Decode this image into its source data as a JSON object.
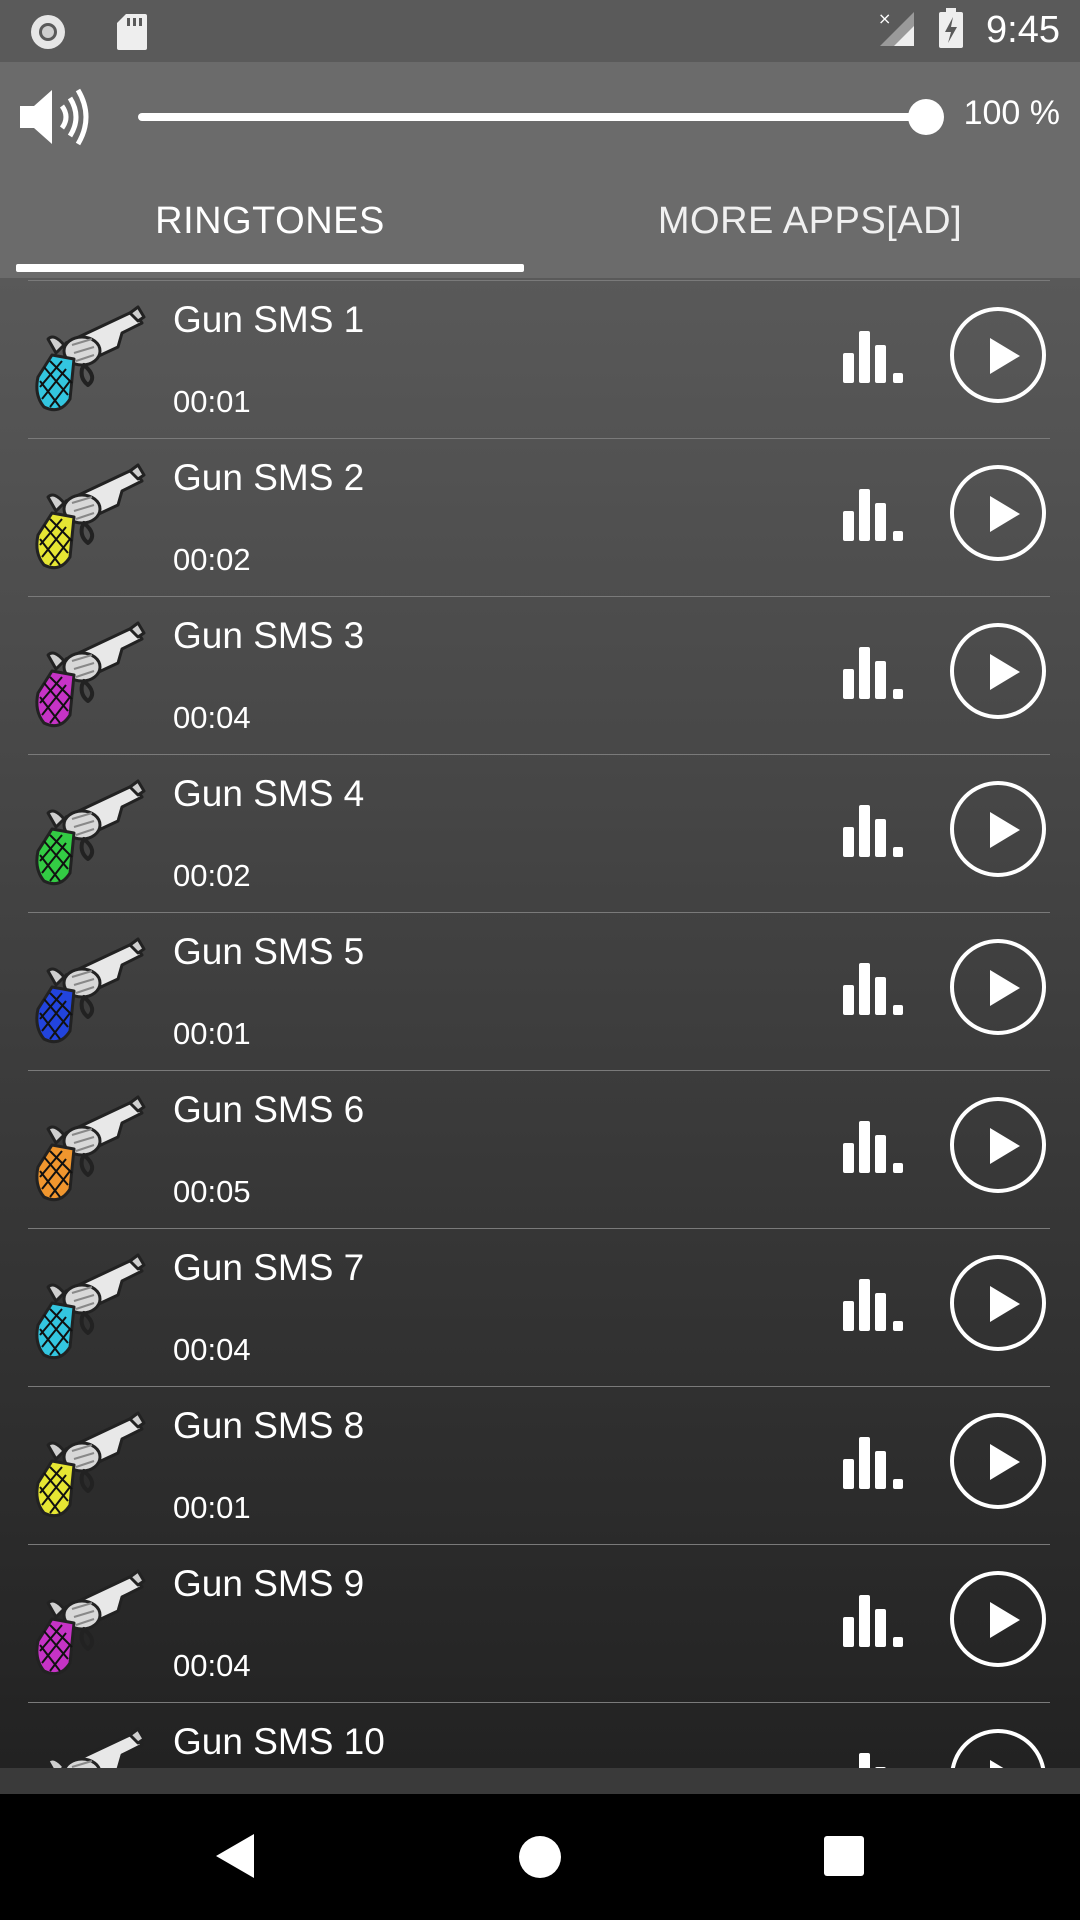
{
  "status_bar": {
    "time": "9:45",
    "icons": [
      "record-icon",
      "sd-card-icon",
      "no-signal-icon",
      "battery-charging-icon"
    ]
  },
  "volume": {
    "icon": "speaker-icon",
    "value_label": "100 %",
    "level_fraction": 1.0
  },
  "tabs": [
    {
      "label": "RINGTONES",
      "active": true
    },
    {
      "label": "MORE APPS[AD]",
      "active": false
    }
  ],
  "colors": {
    "grip_colors": [
      "#33c6e0",
      "#e6e633",
      "#c633c6",
      "#33cc44",
      "#2244dd",
      "#f0962e",
      "#33c6e0",
      "#e6e633",
      "#c633c6",
      "#888888"
    ]
  },
  "ringtones": [
    {
      "title": "Gun SMS 1",
      "duration": "00:01"
    },
    {
      "title": "Gun SMS 2",
      "duration": "00:02"
    },
    {
      "title": "Gun SMS 3",
      "duration": "00:04"
    },
    {
      "title": "Gun SMS 4",
      "duration": "00:02"
    },
    {
      "title": "Gun SMS 5",
      "duration": "00:01"
    },
    {
      "title": "Gun SMS 6",
      "duration": "00:05"
    },
    {
      "title": "Gun SMS 7",
      "duration": "00:04"
    },
    {
      "title": "Gun SMS 8",
      "duration": "00:01"
    },
    {
      "title": "Gun SMS 9",
      "duration": "00:04"
    },
    {
      "title": "Gun SMS 10",
      "duration": ""
    }
  ],
  "nav": {
    "icons": [
      "back-icon",
      "home-icon",
      "recents-icon"
    ]
  }
}
